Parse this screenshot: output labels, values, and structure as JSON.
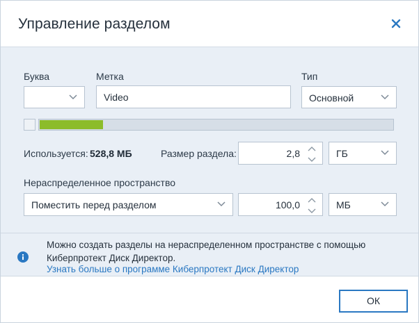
{
  "window": {
    "title": "Управление разделом"
  },
  "labels": {
    "letter": "Буква",
    "label": "Метка",
    "type": "Тип",
    "used": "Используется:",
    "partition_size": "Размер раздела:",
    "unallocated": "Нераспределенное пространство"
  },
  "fields": {
    "letter_value": "",
    "label_value": "Video",
    "type_value": "Основной",
    "used_value": "528,8 МБ",
    "size_value": "2,8",
    "size_unit": "ГБ",
    "placement_value": "Поместить перед разделом",
    "unallocated_value": "100,0",
    "unallocated_unit": "МБ"
  },
  "partition_bar": {
    "used_fraction": 0.18
  },
  "info": {
    "text": "Можно создать разделы на нераспределенном пространстве с помощью Киберпротект Диск Директор.",
    "link": "Узнать больше о программе Киберпротект Диск Директор"
  },
  "buttons": {
    "ok": "ОК"
  },
  "colors": {
    "accent": "#2a78c2",
    "used_bar": "#8cbc2a",
    "panel": "#e9eff6"
  },
  "icons": {
    "close": "close-icon",
    "info": "info-icon",
    "dropdown": "chevron-down-icon"
  }
}
